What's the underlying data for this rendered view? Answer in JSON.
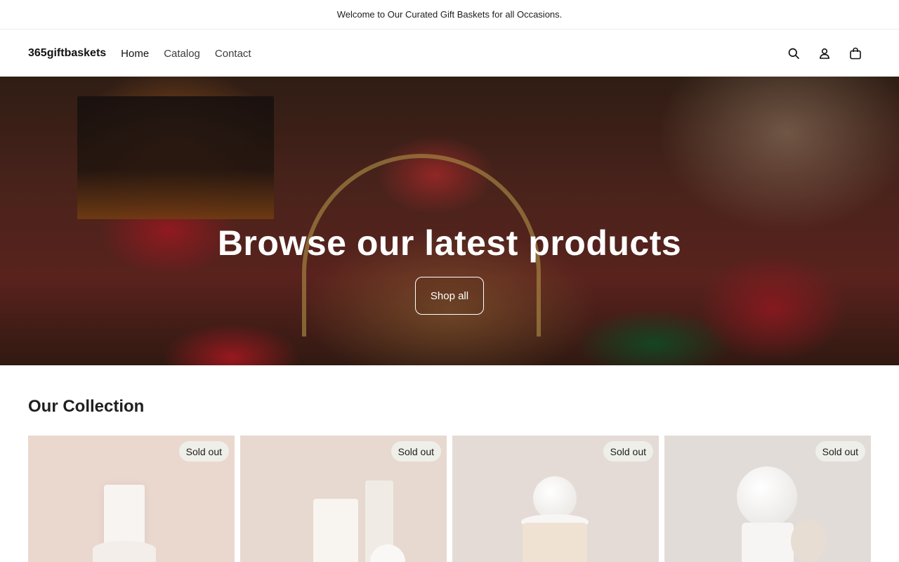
{
  "announcement": {
    "text": "Welcome to Our Curated Gift Baskets for all Occasions."
  },
  "header": {
    "logo": "365giftbaskets",
    "nav": [
      {
        "label": "Home"
      },
      {
        "label": "Catalog"
      },
      {
        "label": "Contact"
      }
    ],
    "icons": [
      "search-icon",
      "account-icon",
      "cart-icon"
    ]
  },
  "hero": {
    "title": "Browse our latest products",
    "button_label": "Shop all"
  },
  "collection": {
    "title": "Our Collection",
    "products": [
      {
        "badge": "Sold out",
        "bg": "#ead8cf"
      },
      {
        "badge": "Sold out",
        "bg": "#e7d9d0"
      },
      {
        "badge": "Sold out",
        "bg": "#e4dbd6"
      },
      {
        "badge": "Sold out",
        "bg": "#e2dcd8"
      }
    ]
  },
  "colors": {
    "text": "#121212",
    "badge_bg": "#efefe9"
  }
}
